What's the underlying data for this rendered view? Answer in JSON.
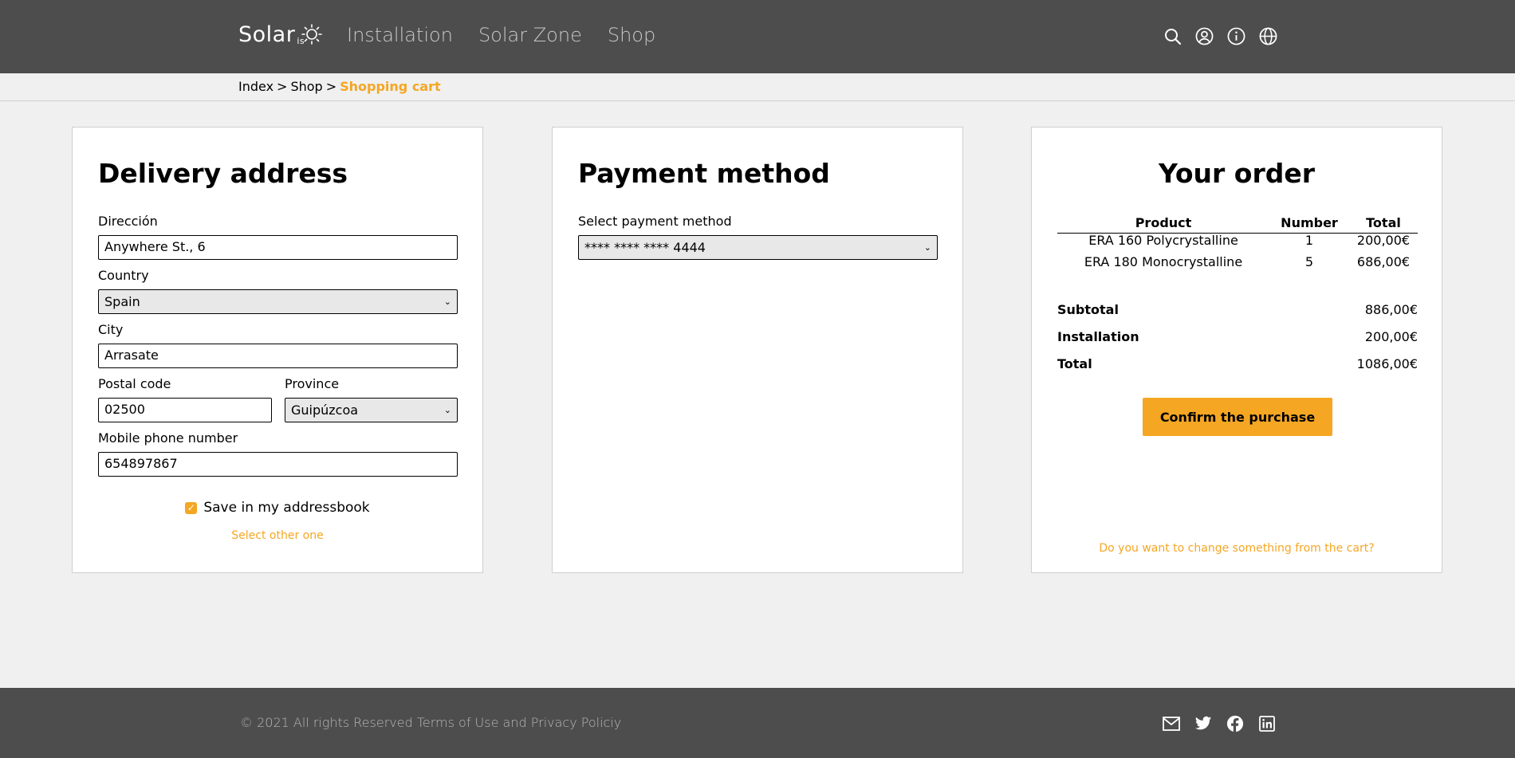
{
  "brand": {
    "name": "Solar",
    "suffix": "is"
  },
  "nav": {
    "items": [
      "Installation",
      "Solar Zone",
      "Shop"
    ]
  },
  "header_icons": [
    "search-icon",
    "user-icon",
    "info-icon",
    "globe-icon"
  ],
  "breadcrumb": {
    "items": [
      "Index",
      "Shop"
    ],
    "current": "Shopping cart",
    "separator": ">"
  },
  "delivery": {
    "title": "Delivery address",
    "address_label": "Dirección",
    "address_value": "Anywhere St., 6",
    "country_label": "Country",
    "country_value": "Spain",
    "city_label": "City",
    "city_value": "Arrasate",
    "postal_label": "Postal code",
    "postal_value": "02500",
    "province_label": "Province",
    "province_value": "Guipúzcoa",
    "phone_label": "Mobile phone number",
    "phone_value": "654897867",
    "save_label": "Save in my addressbook",
    "save_checked": true,
    "other_link": "Select other one"
  },
  "payment": {
    "title": "Payment method",
    "select_label": "Select payment method",
    "select_value": "**** **** **** 4444"
  },
  "order": {
    "title": "Your order",
    "columns": [
      "Product",
      "Number",
      "Total"
    ],
    "rows": [
      {
        "product": "ERA 160 Polycrystalline",
        "number": "1",
        "total": "200,00€"
      },
      {
        "product": "ERA 180 Monocrystalline",
        "number": "5",
        "total": "686,00€"
      }
    ],
    "subtotal_label": "Subtotal",
    "subtotal_value": "886,00€",
    "installation_label": "Installation",
    "installation_value": "200,00€",
    "total_label": "Total",
    "total_value": "1086,00€",
    "confirm_label": "Confirm the purchase",
    "change_link": "Do you want to change something from the cart?"
  },
  "footer": {
    "copyright": "© 2021 All rights Reserved",
    "terms": "Terms of Use",
    "and": "and",
    "privacy": "Privacy Policiy",
    "icons": [
      "mail-icon",
      "twitter-icon",
      "facebook-icon",
      "linkedin-icon"
    ]
  },
  "colors": {
    "accent": "#f5a623",
    "header_bg": "#4d4d4d",
    "page_bg": "#f0f0f0"
  }
}
